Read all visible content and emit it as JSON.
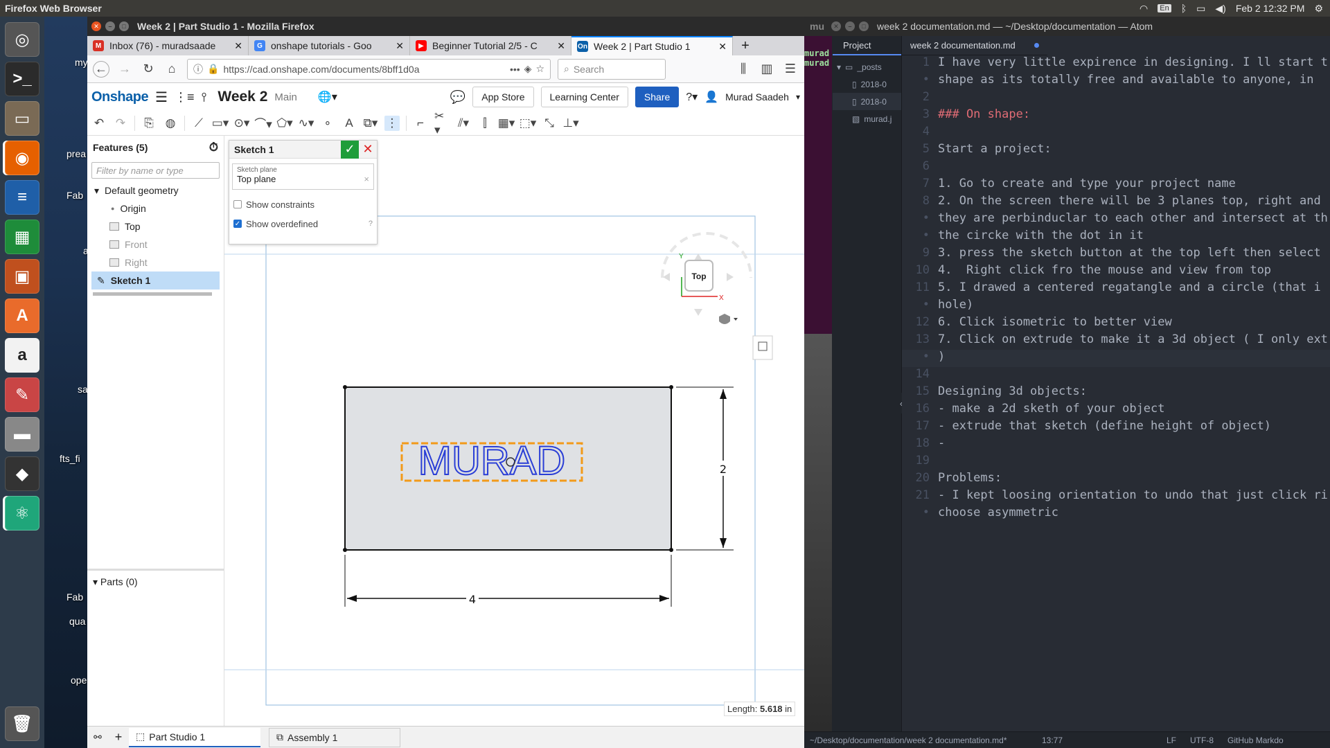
{
  "system": {
    "app_title": "Firefox Web Browser",
    "keyboard": "En",
    "clock": "Feb 2 12:32 PM"
  },
  "desktop": {
    "labels": [
      "my",
      "prea",
      "Fab",
      "a",
      "sa",
      "fts_fi",
      "Fab",
      "qua",
      "ope"
    ]
  },
  "firefox": {
    "window_title": "Week 2 | Part Studio 1 - Mozilla Firefox",
    "tabs": [
      {
        "label": "Inbox (76) - muradsaade",
        "icon": "gmail-icon",
        "color": "#d93025"
      },
      {
        "label": "onshape tutorials - Goo",
        "icon": "google-icon",
        "color": "#4285f4"
      },
      {
        "label": "Beginner Tutorial 2/5 - C",
        "icon": "youtube-icon",
        "color": "#ff0000"
      },
      {
        "label": "Week 2 | Part Studio 1",
        "icon": "onshape-icon",
        "color": "#0b60a9"
      }
    ],
    "url": "https://cad.onshape.com/documents/8bff1d0a",
    "search_placeholder": "Search"
  },
  "onshape": {
    "logo": "Onshape",
    "doc_name": "Week 2",
    "branch": "Main",
    "buttons": {
      "app_store": "App Store",
      "learning": "Learning Center",
      "share": "Share"
    },
    "user": "Murad Saadeh",
    "features_title": "Features (5)",
    "filter_placeholder": "Filter by name or type",
    "tree": {
      "default_geometry": "Default geometry",
      "origin": "Origin",
      "top": "Top",
      "front": "Front",
      "right": "Right",
      "sketch": "Sketch 1"
    },
    "parts": "Parts (0)",
    "sketch_panel": {
      "title": "Sketch 1",
      "plane_label": "Sketch plane",
      "plane_value": "Top plane",
      "show_constraints": "Show constraints",
      "show_overdefined": "Show overdefined"
    },
    "viewcube": {
      "face": "Top",
      "axis_y": "Y",
      "axis_x": "X"
    },
    "sketch": {
      "text": "MURAD",
      "dim_height": "2",
      "dim_width": "4"
    },
    "length_label": "Length:",
    "length_value": "5.618",
    "length_unit": "in",
    "bottom_tabs": [
      "Part Studio 1",
      "Assembly 1"
    ]
  },
  "atom": {
    "window_title": "week 2 documentation.md — ~/Desktop/documentation — Atom",
    "left_strip": [
      "murad",
      "murad"
    ],
    "project_tab": "Project",
    "file_tab": "week 2 documentation.md",
    "tree": [
      "_posts",
      "2018-0",
      "2018-0",
      "murad.j"
    ],
    "lines": [
      {
        "n": "1",
        "text": "I have very little expirence in designing. I ll start t",
        "style": ""
      },
      {
        "n": "•",
        "text": "shape as its totally free and available to anyone, in",
        "style": ""
      },
      {
        "n": "2",
        "text": "",
        "style": ""
      },
      {
        "n": "3",
        "text": "### On shape:",
        "style": "red"
      },
      {
        "n": "4",
        "text": "",
        "style": ""
      },
      {
        "n": "5",
        "text": "Start a project:",
        "style": ""
      },
      {
        "n": "6",
        "text": "",
        "style": ""
      },
      {
        "n": "7",
        "text": "1. Go to create and type your project name",
        "style": ""
      },
      {
        "n": "8",
        "text": "2. On the screen there will be 3 planes top, right and",
        "style": ""
      },
      {
        "n": "•",
        "text": "they are perbinduclar to each other and intersect at th",
        "style": ""
      },
      {
        "n": "•",
        "text": "the circke with the dot in it",
        "style": ""
      },
      {
        "n": "9",
        "text": "3. press the sketch button at the top left then select",
        "style": ""
      },
      {
        "n": "10",
        "text": "4.  Right click fro the mouse and view from top",
        "style": ""
      },
      {
        "n": "11",
        "text": "5. I drawed a centered regatangle and a circle (that i",
        "style": ""
      },
      {
        "n": "•",
        "text": "hole)",
        "style": ""
      },
      {
        "n": "12",
        "text": "6. Click isometric to better view",
        "style": ""
      },
      {
        "n": "13",
        "text": "7. Click on extrude to make it a 3d object ( I only ext",
        "style": ""
      },
      {
        "n": "•",
        "text": ")",
        "style": ""
      },
      {
        "n": "14",
        "text": "",
        "style": ""
      },
      {
        "n": "15",
        "text": "Designing 3d objects:",
        "style": ""
      },
      {
        "n": "16",
        "text": "- make a 2d sketh of your object",
        "style": ""
      },
      {
        "n": "17",
        "text": "- extrude that sketch (define height of object)",
        "style": ""
      },
      {
        "n": "18",
        "text": "-",
        "style": ""
      },
      {
        "n": "19",
        "text": "",
        "style": ""
      },
      {
        "n": "20",
        "text": "Problems:",
        "style": ""
      },
      {
        "n": "21",
        "text": "- I kept loosing orientation to undo that just click ri",
        "style": ""
      },
      {
        "n": "•",
        "text": "choose asymmetric",
        "style": ""
      }
    ],
    "status": {
      "path": "~/Desktop/documentation/week 2 documentation.md*",
      "cursor": "13:77",
      "eol": "LF",
      "encoding": "UTF-8",
      "grammar": "GitHub Markdo"
    }
  }
}
